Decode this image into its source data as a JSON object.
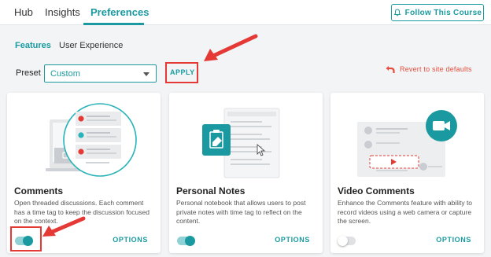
{
  "nav": {
    "tabs": [
      {
        "label": "Hub"
      },
      {
        "label": "Insights"
      },
      {
        "label": "Preferences"
      }
    ],
    "follow_label": "Follow This Course"
  },
  "subtabs": [
    {
      "label": "Features"
    },
    {
      "label": "User Experience"
    }
  ],
  "preset": {
    "label": "Preset",
    "selected": "Custom",
    "apply_label": "APPLY"
  },
  "revert_label": "Revert to site defaults",
  "cards": [
    {
      "title": "Comments",
      "description": "Open threaded discussions. Each comment has a time tag to keep the discussion focused on the context.",
      "options_label": "OPTIONS",
      "enabled": true
    },
    {
      "title": "Personal Notes",
      "description": "Personal notebook that allows users to post private notes with time tag to reflect on the content.",
      "options_label": "OPTIONS",
      "enabled": true
    },
    {
      "title": "Video Comments",
      "description": "Enhance the Comments feature with ability to record videos using a web camera or capture the screen.",
      "options_label": "OPTIONS",
      "enabled": false
    }
  ],
  "colors": {
    "accent": "#1a9aa0",
    "annotation": "#e53935",
    "revert": "#e74c3c"
  }
}
